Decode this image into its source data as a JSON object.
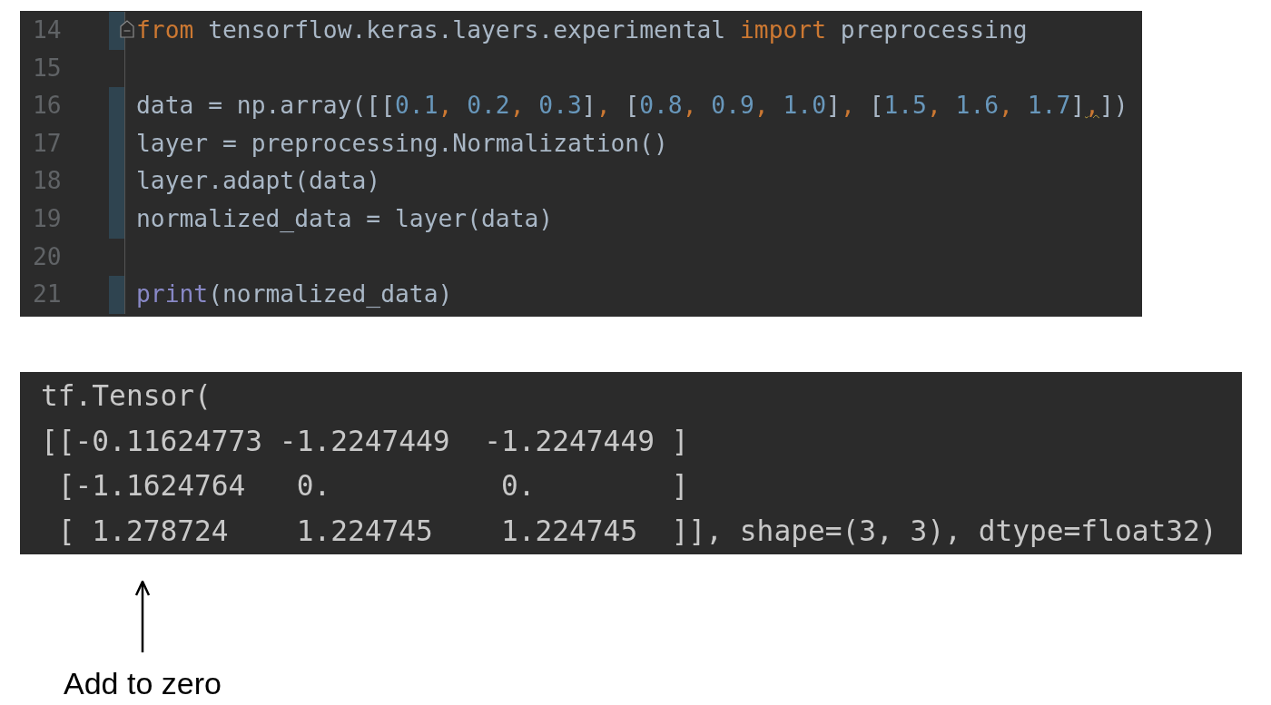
{
  "editor": {
    "lines": [
      {
        "number": "14",
        "changed": true,
        "fold": true,
        "tokens": [
          {
            "kind": "keyword",
            "text": "from"
          },
          {
            "kind": "plain",
            "text": " tensorflow.keras.layers.experimental "
          },
          {
            "kind": "keyword",
            "text": "import"
          },
          {
            "kind": "plain",
            "text": " preprocessing"
          }
        ]
      },
      {
        "number": "15",
        "changed": false,
        "fold": false
      },
      {
        "number": "16",
        "changed": true,
        "fold": false,
        "tokens": [
          {
            "kind": "plain",
            "text": "data = np.array([["
          },
          {
            "kind": "number",
            "text": "0.1"
          },
          {
            "kind": "punct",
            "text": ", "
          },
          {
            "kind": "number",
            "text": "0.2"
          },
          {
            "kind": "punct",
            "text": ", "
          },
          {
            "kind": "number",
            "text": "0.3"
          },
          {
            "kind": "plain",
            "text": "]"
          },
          {
            "kind": "punct",
            "text": ","
          },
          {
            "kind": "plain",
            "text": " ["
          },
          {
            "kind": "number",
            "text": "0.8"
          },
          {
            "kind": "punct",
            "text": ", "
          },
          {
            "kind": "number",
            "text": "0.9"
          },
          {
            "kind": "punct",
            "text": ", "
          },
          {
            "kind": "number",
            "text": "1.0"
          },
          {
            "kind": "plain",
            "text": "]"
          },
          {
            "kind": "punct",
            "text": ","
          },
          {
            "kind": "plain",
            "text": " ["
          },
          {
            "kind": "number",
            "text": "1.5"
          },
          {
            "kind": "punct",
            "text": ", "
          },
          {
            "kind": "number",
            "text": "1.6"
          },
          {
            "kind": "punct",
            "text": ", "
          },
          {
            "kind": "number",
            "text": "1.7"
          },
          {
            "kind": "plain",
            "text": "]"
          },
          {
            "kind": "warning",
            "text": ","
          },
          {
            "kind": "plain",
            "text": "])"
          }
        ]
      },
      {
        "number": "17",
        "changed": true,
        "fold": false,
        "tokens": [
          {
            "kind": "plain",
            "text": "layer = preprocessing.Normalization()"
          }
        ]
      },
      {
        "number": "18",
        "changed": true,
        "fold": false,
        "tokens": [
          {
            "kind": "plain",
            "text": "layer.adapt(data)"
          }
        ]
      },
      {
        "number": "19",
        "changed": true,
        "fold": false,
        "tokens": [
          {
            "kind": "plain",
            "text": "normalized_data = layer(data)"
          }
        ]
      },
      {
        "number": "20",
        "changed": false,
        "fold": false
      },
      {
        "number": "21",
        "changed": true,
        "fold": false,
        "tokens": [
          {
            "kind": "builtin",
            "text": "print"
          },
          {
            "kind": "plain",
            "text": "(normalized_data)"
          }
        ]
      }
    ]
  },
  "output": {
    "lines": [
      "tf.Tensor(",
      "[[-0.11624773 -1.2247449  -1.2247449 ]",
      " [-1.1624764   0.          0.        ]",
      " [ 1.278724    1.224745    1.224745  ]], shape=(3, 3), dtype=float32)"
    ]
  },
  "annotation": {
    "label": "Add to zero"
  }
}
